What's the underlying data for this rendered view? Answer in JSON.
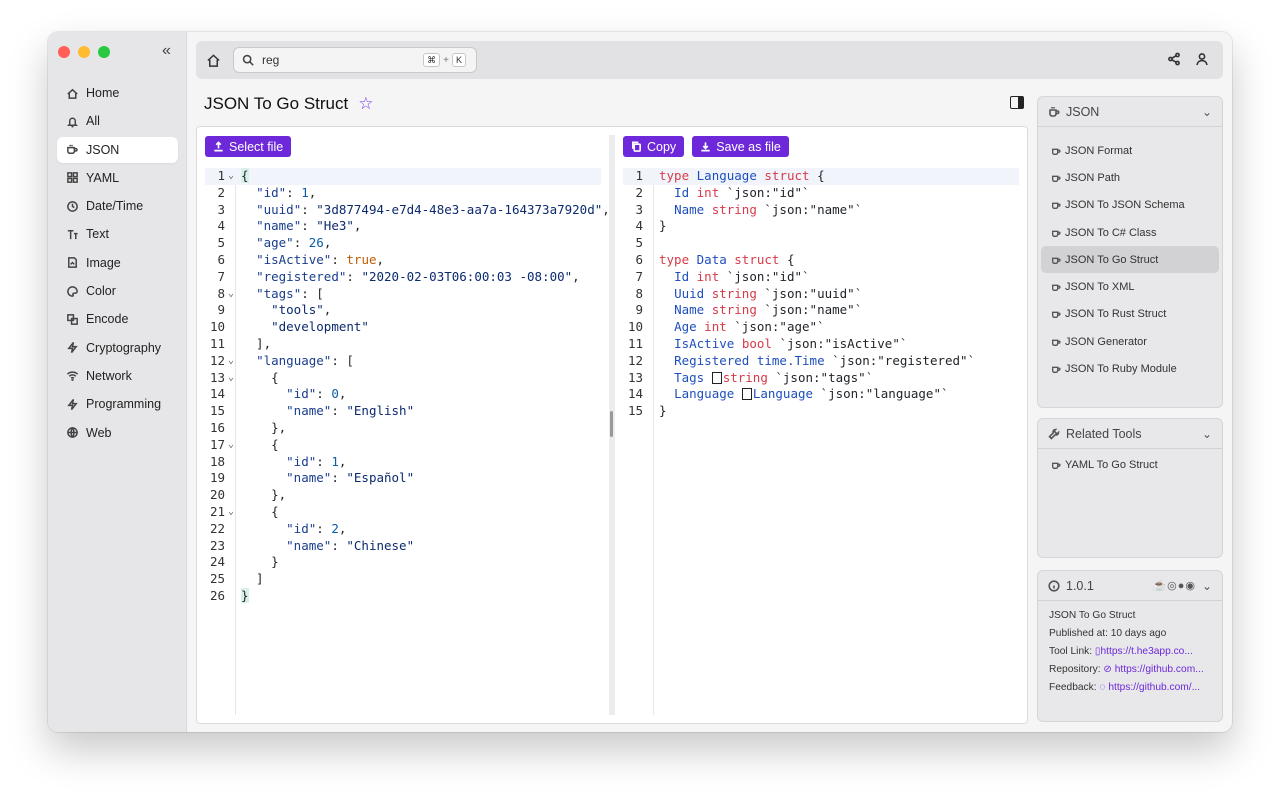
{
  "sidebar": {
    "items": [
      {
        "label": "Home",
        "icon": "home-icon"
      },
      {
        "label": "All",
        "icon": "bell-icon"
      },
      {
        "label": "JSON",
        "icon": "cup-icon",
        "active": true
      },
      {
        "label": "YAML",
        "icon": "grid-icon"
      },
      {
        "label": "Date/Time",
        "icon": "clock-icon"
      },
      {
        "label": "Text",
        "icon": "text-icon"
      },
      {
        "label": "Image",
        "icon": "image-icon"
      },
      {
        "label": "Color",
        "icon": "palette-icon"
      },
      {
        "label": "Encode",
        "icon": "encode-icon"
      },
      {
        "label": "Cryptography",
        "icon": "bolt-icon"
      },
      {
        "label": "Network",
        "icon": "wifi-icon"
      },
      {
        "label": "Programming",
        "icon": "bolt-icon"
      },
      {
        "label": "Web",
        "icon": "globe-icon"
      }
    ]
  },
  "topbar": {
    "search_value": "reg",
    "shortcut_mod": "⌘",
    "shortcut_plus": "+",
    "shortcut_key": "K"
  },
  "page": {
    "title": "JSON To Go Struct"
  },
  "left_pane": {
    "select_file_label": "Select file"
  },
  "right_pane": {
    "copy_label": "Copy",
    "save_label": "Save as file"
  },
  "json_panel": {
    "title": "JSON",
    "tools": [
      "JSON Format",
      "JSON Path",
      "JSON To JSON Schema",
      "JSON To C# Class",
      "JSON To Go Struct",
      "JSON To XML",
      "JSON To Rust Struct",
      "JSON Generator",
      "JSON To Ruby Module"
    ],
    "active_tool": "JSON To Go Struct"
  },
  "related_panel": {
    "title": "Related Tools",
    "tools": [
      "YAML To Go Struct"
    ]
  },
  "info_panel": {
    "version": "1.0.1",
    "name": "JSON To Go Struct",
    "published": "Published at: 10 days ago",
    "tool_link_label": "Tool Link:",
    "tool_link": "https://t.he3app.co...",
    "repo_label": "Repository:",
    "repo_link": "https://github.com...",
    "feedback_label": "Feedback:",
    "feedback_link": "https://github.com/..."
  },
  "colors": {
    "accent": "#6d28d9",
    "keyword": "#d73a49",
    "type": "#1f4fbf",
    "string": "#0b2a6f"
  }
}
